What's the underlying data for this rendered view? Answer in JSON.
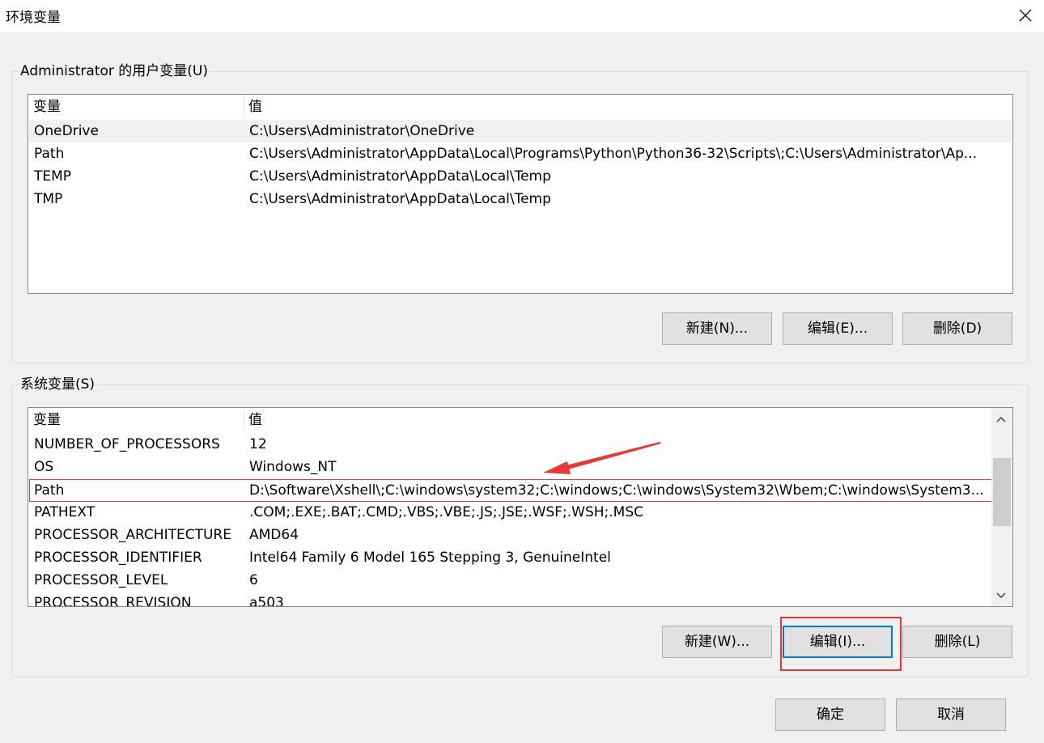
{
  "window": {
    "title": "环境变量",
    "close_icon": "close-icon"
  },
  "user_vars": {
    "legend": "Administrator 的用户变量(U)",
    "headers": {
      "name": "变量",
      "value": "值"
    },
    "rows": [
      {
        "name": "OneDrive",
        "value": "C:\\Users\\Administrator\\OneDrive"
      },
      {
        "name": "Path",
        "value": "C:\\Users\\Administrator\\AppData\\Local\\Programs\\Python\\Python36-32\\Scripts\\;C:\\Users\\Administrator\\Ap..."
      },
      {
        "name": "TEMP",
        "value": "C:\\Users\\Administrator\\AppData\\Local\\Temp"
      },
      {
        "name": "TMP",
        "value": "C:\\Users\\Administrator\\AppData\\Local\\Temp"
      }
    ],
    "buttons": {
      "new": "新建(N)...",
      "edit": "编辑(E)...",
      "delete": "删除(D)"
    }
  },
  "system_vars": {
    "legend": "系统变量(S)",
    "headers": {
      "name": "变量",
      "value": "值"
    },
    "rows": [
      {
        "name": "NUMBER_OF_PROCESSORS",
        "value": "12"
      },
      {
        "name": "OS",
        "value": "Windows_NT"
      },
      {
        "name": "Path",
        "value": "D:\\Software\\Xshell\\;C:\\windows\\system32;C:\\windows;C:\\windows\\System32\\Wbem;C:\\windows\\System3..."
      },
      {
        "name": "PATHEXT",
        "value": ".COM;.EXE;.BAT;.CMD;.VBS;.VBE;.JS;.JSE;.WSF;.WSH;.MSC"
      },
      {
        "name": "PROCESSOR_ARCHITECTURE",
        "value": "AMD64"
      },
      {
        "name": "PROCESSOR_IDENTIFIER",
        "value": "Intel64 Family 6 Model 165 Stepping 3, GenuineIntel"
      },
      {
        "name": "PROCESSOR_LEVEL",
        "value": "6"
      },
      {
        "name": "PROCESSOR_REVISION",
        "value": "a503"
      }
    ],
    "buttons": {
      "new": "新建(W)...",
      "edit": "编辑(I)...",
      "delete": "删除(L)"
    }
  },
  "footer": {
    "ok": "确定",
    "cancel": "取消"
  },
  "colors": {
    "annotation_red": "#e53935",
    "focus_blue": "#0078d7"
  }
}
